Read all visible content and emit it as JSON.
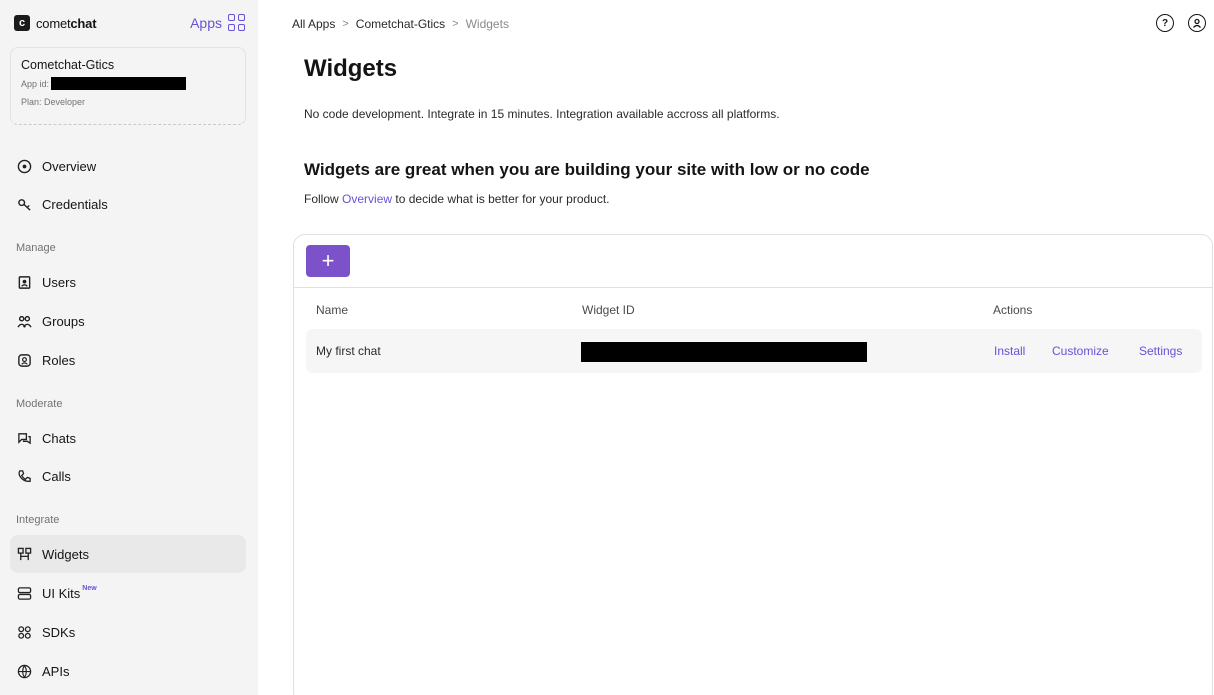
{
  "brand": {
    "logo_letter": "c",
    "name_prefix": "comet",
    "name_suffix": "chat"
  },
  "apps_link": "Apps",
  "app_card": {
    "name": "Cometchat-Gtics",
    "app_id_label": "App id:",
    "plan": "Plan: Developer"
  },
  "sidebar": {
    "top_items": [
      {
        "label": "Overview",
        "icon": "overview-icon"
      },
      {
        "label": "Credentials",
        "icon": "credentials-icon"
      }
    ],
    "section_manage": "Manage",
    "manage_items": [
      {
        "label": "Users",
        "icon": "users-icon"
      },
      {
        "label": "Groups",
        "icon": "groups-icon"
      },
      {
        "label": "Roles",
        "icon": "roles-icon"
      }
    ],
    "section_moderate": "Moderate",
    "moderate_items": [
      {
        "label": "Chats",
        "icon": "chats-icon"
      },
      {
        "label": "Calls",
        "icon": "calls-icon"
      }
    ],
    "section_integrate": "Integrate",
    "integrate_items": [
      {
        "label": "Widgets",
        "icon": "widgets-icon",
        "active": true
      },
      {
        "label": "UI Kits",
        "icon": "ui-kits-icon",
        "badge": "New"
      },
      {
        "label": "SDKs",
        "icon": "sdks-icon"
      },
      {
        "label": "APIs",
        "icon": "apis-icon"
      }
    ]
  },
  "breadcrumb": {
    "root": "All Apps",
    "sep": ">",
    "app": "Cometchat-Gtics",
    "current": "Widgets"
  },
  "page": {
    "title": "Widgets",
    "subtitle": "No code development. Integrate in 15 minutes. Integration available accross all platforms.",
    "section_title": "Widgets are great when you are building your site with low or no code",
    "section_desc_prefix": "Follow",
    "section_desc_link": "Overview",
    "section_desc_suffix": "to decide what is better for your product."
  },
  "table": {
    "add_label": "+",
    "columns": {
      "name": "Name",
      "id": "Widget ID",
      "actions": "Actions"
    },
    "rows": [
      {
        "name": "My first chat",
        "actions": [
          "Install",
          "Customize",
          "Settings"
        ]
      }
    ]
  },
  "colors": {
    "accent": "#6852d6",
    "button": "#7b52c9",
    "sidebar_bg": "#f4f4f5"
  }
}
